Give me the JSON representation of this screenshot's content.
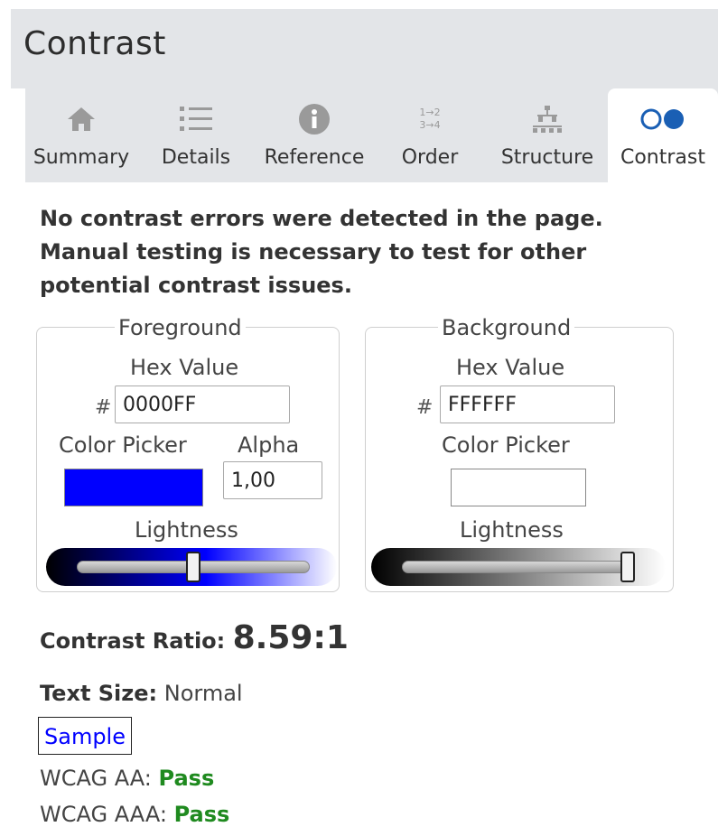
{
  "header": {
    "title": "Contrast"
  },
  "tabs": [
    {
      "label": "Summary",
      "icon": "home-icon"
    },
    {
      "label": "Details",
      "icon": "list-icon"
    },
    {
      "label": "Reference",
      "icon": "info-icon"
    },
    {
      "label": "Order",
      "icon": "order-icon",
      "icon_text": [
        "1→2",
        "3→4"
      ]
    },
    {
      "label": "Structure",
      "icon": "structure-icon"
    },
    {
      "label": "Contrast",
      "icon": "contrast-icon"
    }
  ],
  "active_tab": "Contrast",
  "message": "No contrast errors were detected in the page. Manual testing is necessary to test for other potential contrast issues.",
  "foreground": {
    "legend": "Foreground",
    "hex_label": "Hex Value",
    "hash": "#",
    "hex_value": "0000FF",
    "picker_label": "Color Picker",
    "alpha_label": "Alpha",
    "alpha_value": "1,00",
    "lightness_label": "Lightness",
    "lightness_level": 0.5,
    "color": "#0000ff"
  },
  "background": {
    "legend": "Background",
    "hex_label": "Hex Value",
    "hash": "#",
    "hex_value": "FFFFFF",
    "picker_label": "Color Picker",
    "lightness_label": "Lightness",
    "lightness_level": 1.0,
    "color": "#ffffff"
  },
  "ratio": {
    "label": "Contrast Ratio: ",
    "value": "8.59:1"
  },
  "text_size": {
    "label": "Text Size:",
    "value": " Normal"
  },
  "sample": {
    "text": "Sample"
  },
  "wcag": [
    {
      "label": "WCAG AA: ",
      "result": "Pass"
    },
    {
      "label": "WCAG AAA: ",
      "result": "Pass"
    }
  ],
  "colors": {
    "pass": "#1f8a1f",
    "icon": "#9a9a9a",
    "contrast_icon": "#1a5fb4"
  }
}
